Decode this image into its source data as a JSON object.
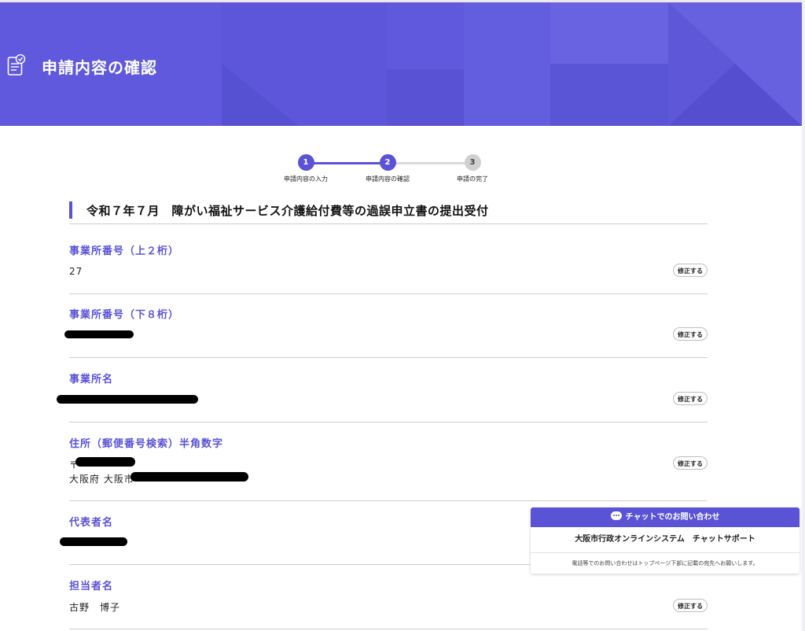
{
  "header": {
    "title": "申請内容の確認",
    "icon": "clipboard-check-icon",
    "background": "#6059de"
  },
  "stepper": {
    "steps": [
      {
        "number": "1",
        "label": "申請内容の入力",
        "state": "done"
      },
      {
        "number": "2",
        "label": "申請内容の確認",
        "state": "current"
      },
      {
        "number": "3",
        "label": "申請の完了",
        "state": "pending"
      }
    ]
  },
  "section": {
    "title": "令和７年７月　障がい福祉サービス介護給付費等の過誤申立書の提出受付"
  },
  "fields": [
    {
      "label": "事業所番号（上２桁）",
      "value": "27"
    },
    {
      "label": "事業所番号（下８桁）",
      "value": ""
    },
    {
      "label": "事業所名",
      "value": ""
    },
    {
      "label": "住所（郵便番号検索）半角数字",
      "value_line1": "〒",
      "value_line2": "大阪府 大阪市"
    },
    {
      "label": "代表者名",
      "value": ""
    },
    {
      "label": "担当者名",
      "value": "古野　博子"
    }
  ],
  "edit_label": "修正する",
  "chat": {
    "header": "チャットでのお問い合わせ",
    "system_name": "大阪市行政オンラインシステム　チャットサポート",
    "note": "電話等でのお問い合わせはトップページ下部に記載の宛先へお願いします。",
    "accent": "#5a53d6"
  }
}
